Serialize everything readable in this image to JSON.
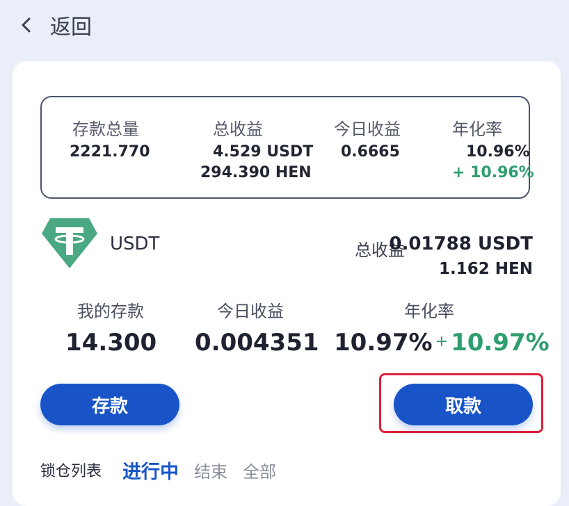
{
  "header": {
    "back_label": "返回"
  },
  "summary": {
    "deposit_total": {
      "label": "存款总量",
      "value": "2221.770"
    },
    "total_earnings": {
      "label": "总收益",
      "value_usdt": "4.529 USDT",
      "value_hen": "294.390 HEN"
    },
    "today_earnings": {
      "label": "今日收益",
      "value": "0.6665"
    },
    "apr": {
      "label": "年化率",
      "value": "10.96%",
      "bonus": "+ 10.96%"
    }
  },
  "coin": {
    "name": "USDT",
    "logo_icon": "tether-icon",
    "earnings_label": "总收益",
    "earnings_usdt": "0.01788 USDT",
    "earnings_hen": "1.162 HEN"
  },
  "stats": {
    "my_deposit": {
      "label": "我的存款",
      "value": "14.300"
    },
    "today_earnings": {
      "label": "今日收益",
      "value": "0.004351"
    },
    "apr": {
      "label": "年化率",
      "value": "10.97%",
      "plus": "+",
      "bonus": "10.97%"
    }
  },
  "actions": {
    "deposit_label": "存款",
    "withdraw_label": "取款"
  },
  "lock_list": {
    "label": "锁仓列表",
    "tabs": [
      {
        "label": "进行中",
        "active": true
      },
      {
        "label": "结束",
        "active": false
      },
      {
        "label": "全部",
        "active": false
      }
    ]
  },
  "colors": {
    "accent": "#1854c8",
    "positive": "#2e9e6e",
    "tether": "#4aa883",
    "highlight": "#e0203a",
    "background": "#e9eef9"
  }
}
